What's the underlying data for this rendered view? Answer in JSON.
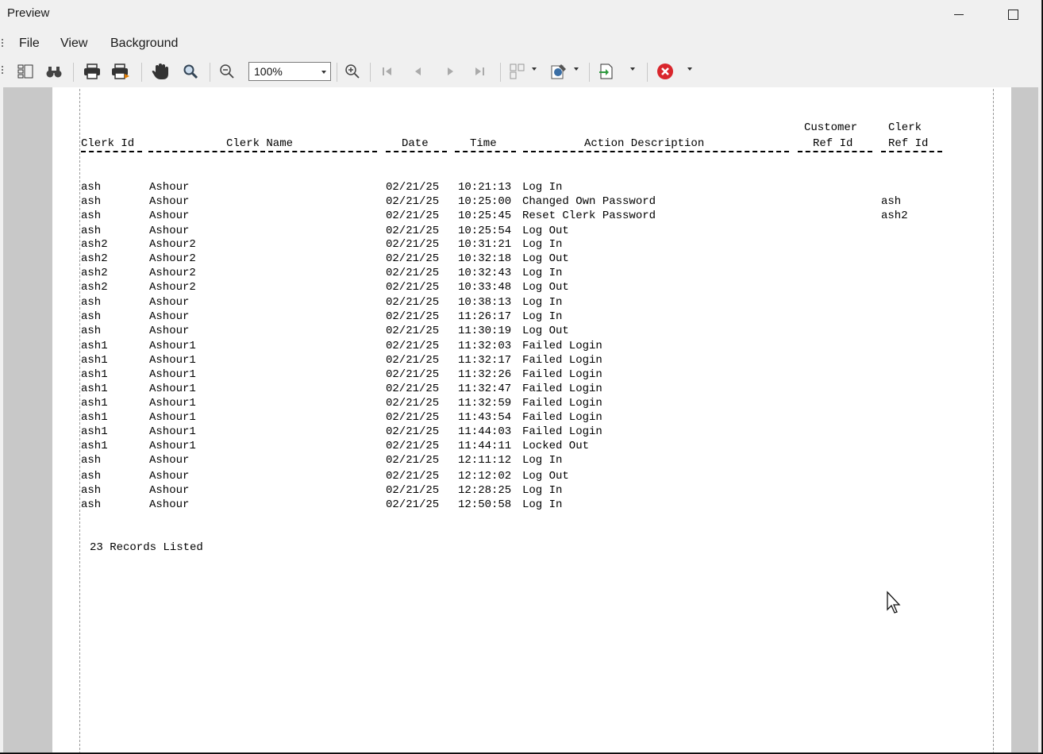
{
  "window": {
    "title": "Preview"
  },
  "menu": [
    "File",
    "View",
    "Background"
  ],
  "toolbar": {
    "zoom_value": "100%"
  },
  "report": {
    "headers": {
      "clerk_id": "Clerk Id",
      "clerk_name": "Clerk Name",
      "date": "Date",
      "time": "Time",
      "action": "Action Description",
      "customer_ref_1": "Customer",
      "customer_ref_2": "Ref Id",
      "clerk_ref_1": "Clerk",
      "clerk_ref_2": "Ref Id"
    },
    "rows": [
      {
        "id": "ash",
        "name": "Ashour",
        "date": "02/21/25",
        "time": "10:21:13",
        "action": "Log In",
        "clerk_ref": ""
      },
      {
        "id": "ash",
        "name": "Ashour",
        "date": "02/21/25",
        "time": "10:25:00",
        "action": "Changed Own Password",
        "clerk_ref": "ash"
      },
      {
        "id": "ash",
        "name": "Ashour",
        "date": "02/21/25",
        "time": "10:25:45",
        "action": "Reset Clerk Password",
        "clerk_ref": "ash2"
      },
      {
        "id": "ash",
        "name": "Ashour",
        "date": "02/21/25",
        "time": "10:25:54",
        "action": "Log Out",
        "clerk_ref": ""
      },
      {
        "id": "ash2",
        "name": "Ashour2",
        "date": "02/21/25",
        "time": "10:31:21",
        "action": "Log In",
        "clerk_ref": ""
      },
      {
        "id": "ash2",
        "name": "Ashour2",
        "date": "02/21/25",
        "time": "10:32:18",
        "action": "Log Out",
        "clerk_ref": ""
      },
      {
        "id": "ash2",
        "name": "Ashour2",
        "date": "02/21/25",
        "time": "10:32:43",
        "action": "Log In",
        "clerk_ref": ""
      },
      {
        "id": "ash2",
        "name": "Ashour2",
        "date": "02/21/25",
        "time": "10:33:48",
        "action": "Log Out",
        "clerk_ref": ""
      },
      {
        "id": "ash",
        "name": "Ashour",
        "date": "02/21/25",
        "time": "10:38:13",
        "action": "Log In",
        "clerk_ref": ""
      },
      {
        "id": "ash",
        "name": "Ashour",
        "date": "02/21/25",
        "time": "11:26:17",
        "action": "Log In",
        "clerk_ref": ""
      },
      {
        "id": "ash",
        "name": "Ashour",
        "date": "02/21/25",
        "time": "11:30:19",
        "action": "Log Out",
        "clerk_ref": ""
      },
      {
        "id": "ash1",
        "name": "Ashour1",
        "date": "02/21/25",
        "time": "11:32:03",
        "action": "Failed Login",
        "clerk_ref": ""
      },
      {
        "id": "ash1",
        "name": "Ashour1",
        "date": "02/21/25",
        "time": "11:32:17",
        "action": "Failed Login",
        "clerk_ref": ""
      },
      {
        "id": "ash1",
        "name": "Ashour1",
        "date": "02/21/25",
        "time": "11:32:26",
        "action": "Failed Login",
        "clerk_ref": ""
      },
      {
        "id": "ash1",
        "name": "Ashour1",
        "date": "02/21/25",
        "time": "11:32:47",
        "action": "Failed Login",
        "clerk_ref": ""
      },
      {
        "id": "ash1",
        "name": "Ashour1",
        "date": "02/21/25",
        "time": "11:32:59",
        "action": "Failed Login",
        "clerk_ref": ""
      },
      {
        "id": "ash1",
        "name": "Ashour1",
        "date": "02/21/25",
        "time": "11:43:54",
        "action": "Failed Login",
        "clerk_ref": ""
      },
      {
        "id": "ash1",
        "name": "Ashour1",
        "date": "02/21/25",
        "time": "11:44:03",
        "action": "Failed Login",
        "clerk_ref": ""
      },
      {
        "id": "ash1",
        "name": "Ashour1",
        "date": "02/21/25",
        "time": "11:44:11",
        "action": "Locked Out",
        "clerk_ref": ""
      },
      {
        "id": "ash",
        "name": "Ashour",
        "date": "02/21/25",
        "time": "12:11:12",
        "action": "Log In",
        "clerk_ref": ""
      },
      {
        "id": "ash",
        "name": "Ashour",
        "date": "02/21/25",
        "time": "12:12:02",
        "action": "Log Out",
        "clerk_ref": ""
      },
      {
        "id": "ash",
        "name": "Ashour",
        "date": "02/21/25",
        "time": "12:28:25",
        "action": "Log In",
        "clerk_ref": ""
      },
      {
        "id": "ash",
        "name": "Ashour",
        "date": "02/21/25",
        "time": "12:50:58",
        "action": "Log In",
        "clerk_ref": ""
      }
    ],
    "summary": "23 Records Listed"
  },
  "icons": [
    "thumbnails-icon",
    "find-icon",
    "print-icon",
    "quick-print-icon",
    "hand-tool-icon",
    "magnifier-icon",
    "zoom-out-icon",
    "zoom-in-icon",
    "first-page-icon",
    "previous-page-icon",
    "next-page-icon",
    "last-page-icon",
    "multiple-pages-icon",
    "color-icon",
    "export-icon",
    "close-preview-icon"
  ]
}
